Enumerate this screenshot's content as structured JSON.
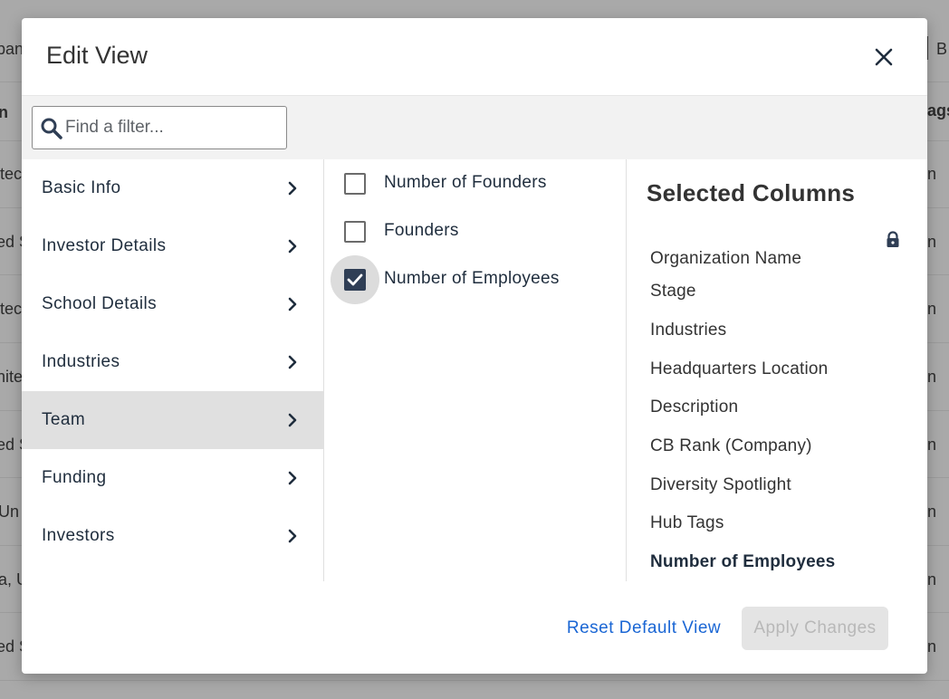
{
  "modal": {
    "title": "Edit View"
  },
  "search": {
    "placeholder": "Find a filter..."
  },
  "categories": [
    {
      "label": "Basic Info",
      "active": false
    },
    {
      "label": "Investor Details",
      "active": false
    },
    {
      "label": "School Details",
      "active": false
    },
    {
      "label": "Industries",
      "active": false
    },
    {
      "label": "Team",
      "active": true
    },
    {
      "label": "Funding",
      "active": false
    },
    {
      "label": "Investors",
      "active": false
    }
  ],
  "filters": [
    {
      "label": "Number of Founders",
      "checked": false
    },
    {
      "label": "Founders",
      "checked": false
    },
    {
      "label": "Number of Employees",
      "checked": true
    }
  ],
  "selected": {
    "title": "Selected Columns",
    "items": [
      "Organization Name",
      "Stage",
      "Industries",
      "Headquarters Location",
      "Description",
      "CB Rank (Company)",
      "Diversity Spotlight",
      "Hub Tags",
      "Number of Employees"
    ]
  },
  "footer": {
    "reset_label": "Reset Default View",
    "apply_label": "Apply Changes"
  },
  "background": {
    "left_fragments": [
      "pan",
      "n",
      "itec",
      "ed S",
      "itec",
      "nite",
      "ed S",
      "Un",
      "a, U",
      "ed S"
    ],
    "right_fragments": [
      "B",
      "ags",
      "n",
      "n",
      "n",
      "n",
      "n",
      "n",
      "n",
      "n"
    ]
  },
  "colors": {
    "accent": "#1a66d4",
    "checkbox": "#2f3e55",
    "active_row": "#e0e0e0"
  }
}
